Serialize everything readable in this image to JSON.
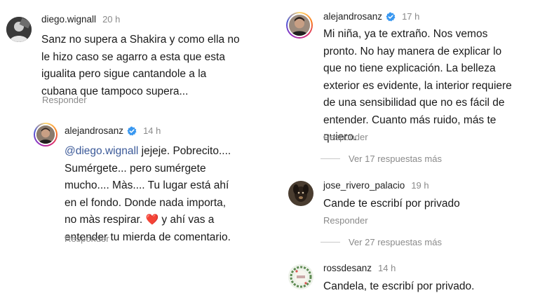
{
  "left": {
    "comment1": {
      "username": "diego.wignall",
      "time": "20 h",
      "lines": [
        "Sanz no supera a Shakira y como ella no",
        "le hizo caso se agarro a esta que esta",
        "igualita pero sigue cantandole a la",
        "cubana que tampoco supera..."
      ],
      "reply_label": "Responder"
    },
    "comment2": {
      "username": "alejandrosanz",
      "time": "14 h",
      "mention": "@diego.wignall",
      "line1_rest": " jejeje. Pobrecito....",
      "lines": [
        "Sumérgete... pero sumérgete",
        "mucho.... Màs.... Tu lugar está ahí",
        "en el fondo. Donde nada importa,"
      ],
      "line5_before": "no màs respirar. ",
      "heart": "❤️",
      "line5_after": " y ahí vas a",
      "line6": "entender tu mierda de comentario.",
      "reply_label": "Responder"
    }
  },
  "right": {
    "comment1": {
      "username": "alejandrosanz",
      "time": "17 h",
      "lines": [
        "Mi niña, ya te extraño. Nos vemos",
        "pronto. No hay manera de explicar lo",
        "que no tiene explicación. La belleza",
        "exterior es evidente, la interior requiere",
        "de una sensibilidad que no es fácil de",
        "entender. Cuanto más ruido, más te",
        "quiero."
      ],
      "reply_label": "Responder",
      "more_replies": "Ver 17 respuestas más"
    },
    "comment2": {
      "username": "jose_rivero_palacio",
      "time": "19 h",
      "lines": [
        "Cande te escribí por privado"
      ],
      "reply_label": "Responder",
      "more_replies": "Ver 27 respuestas más"
    },
    "comment3": {
      "username": "rossdesanz",
      "time": "14 h",
      "lines": [
        "Candela, te escribí por privado."
      ]
    }
  },
  "colors": {
    "verified": "#3897f0",
    "mention": "#3b5998",
    "secondary_text": "#8a8a8a"
  },
  "icons": {
    "verified": "verified-badge-icon",
    "heart": "red-heart-emoji"
  }
}
